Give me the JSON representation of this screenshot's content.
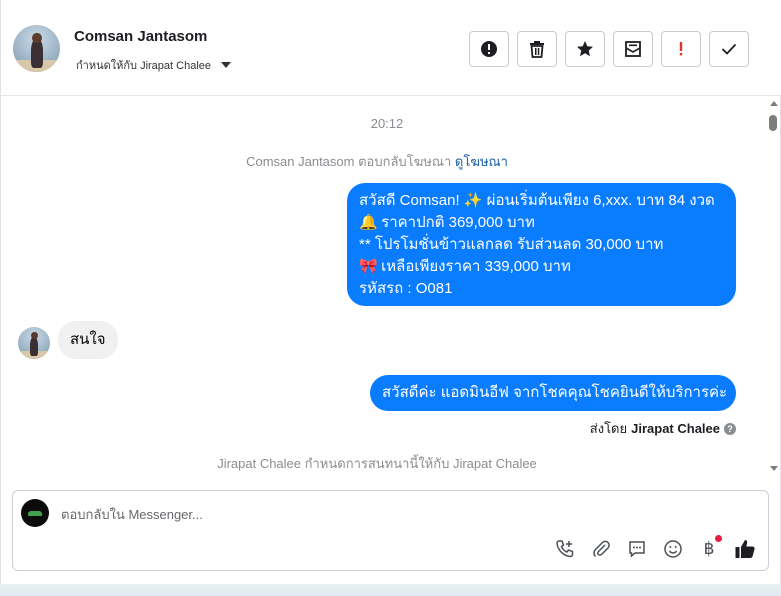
{
  "header": {
    "contact_name": "Comsan Jantasom",
    "assigned_label": "กำหนดให้กับ Jirapat Chalee",
    "toolbar": [
      {
        "name": "spam-button",
        "icon": "exclamation-circle-icon"
      },
      {
        "name": "delete-button",
        "icon": "trash-icon"
      },
      {
        "name": "star-button",
        "icon": "star-icon"
      },
      {
        "name": "mark-unread-button",
        "icon": "envelope-icon"
      },
      {
        "name": "follow-up-button",
        "icon": "exclamation-icon"
      },
      {
        "name": "mark-done-button",
        "icon": "check-icon"
      }
    ]
  },
  "conversation": {
    "timestamp": "20:12",
    "ad_reply_text": "Comsan Jantasom ตอบกลับโฆษณา",
    "ad_reply_link": "ดูโฆษณา",
    "outgoing_message_1": {
      "lines": [
        {
          "emoji": "",
          "text": "สวัสดี Comsan! ✨  ผ่อนเริ่มต้นเพียง 6,xxx. บาท 84 งวด"
        },
        {
          "emoji": "🔔",
          "text": " ราคาปกติ 369,000 บาท"
        },
        {
          "emoji": "",
          "text": "** โปรโมชั่นข้าวแลกลด รับส่วนลด 30,000 บาท"
        },
        {
          "emoji": "🎀",
          "text": "  เหลือเพียงราคา 339,000 บาท"
        },
        {
          "emoji": "",
          "text": " รหัสรถ : O081"
        }
      ]
    },
    "incoming_message": "สนใจ",
    "outgoing_message_2": "สวัสดีค่ะ แอดมินอีฟ จากโชคคุณโชคยินดีให้บริการค่ะ",
    "sent_by_prefix": "ส่งโดย",
    "sent_by_name": "Jirapat Chalee",
    "assignment_notice": "Jirapat Chalee กำหนดการสนทนานี้ให้กับ Jirapat Chalee"
  },
  "composer": {
    "placeholder": "ตอบกลับใน Messenger...",
    "tools": [
      "phone-plus-icon",
      "paperclip-icon",
      "chat-bubble-icon",
      "smiley-icon",
      "baht-icon",
      "thumbs-up-icon"
    ]
  },
  "colors": {
    "outgoing_bubble": "#0a7cff",
    "incoming_bubble": "#f0f0f0",
    "link": "#1a5fa8",
    "notification_dot": "#e41e3f"
  }
}
